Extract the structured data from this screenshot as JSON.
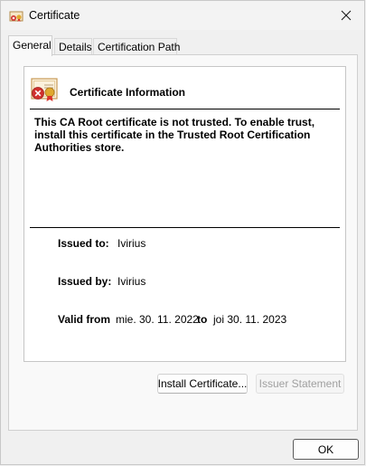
{
  "window": {
    "title": "Certificate",
    "app_icon": "certificate-icon"
  },
  "tabs": [
    {
      "label": "General",
      "active": true
    },
    {
      "label": "Details",
      "active": false
    },
    {
      "label": "Certification Path",
      "active": false
    }
  ],
  "general": {
    "heading": "Certificate Information",
    "warning": "This CA Root certificate is not trusted. To enable trust, install this certificate in the Trusted Root Certification Authorities store.",
    "issued_to_label": "Issued to:",
    "issued_to_value": "Ivirius",
    "issued_by_label": "Issued by:",
    "issued_by_value": "Ivirius",
    "valid_from_label": "Valid from",
    "valid_from_value": "mie. 30. 11. 2022",
    "valid_to_label": "to",
    "valid_to_value": "joi 30. 11. 2023"
  },
  "buttons": {
    "install": "Install Certificate...",
    "issuer_statement": "Issuer Statement",
    "ok": "OK"
  },
  "colors": {
    "window_bg": "#f0f0f0",
    "panel_bg": "#f9f9f9",
    "error_red": "#d0312d",
    "ribbon_gold": "#e0a82e"
  }
}
